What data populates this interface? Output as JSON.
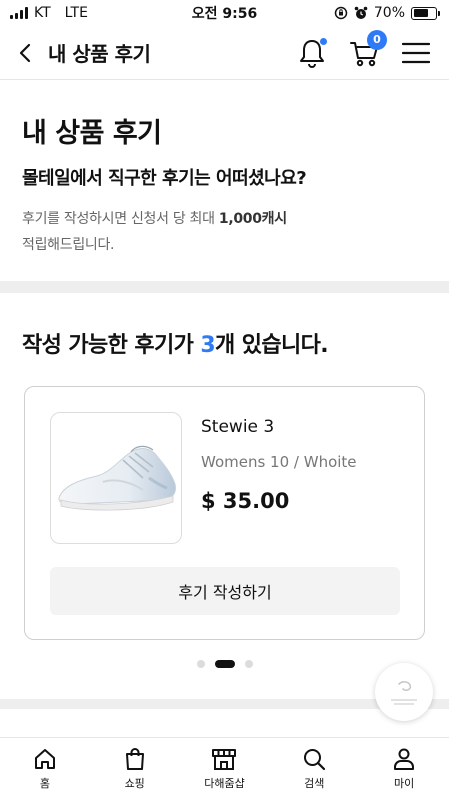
{
  "status_bar": {
    "carrier": "KT",
    "network": "LTE",
    "time": "오전 9:56",
    "battery": "70%",
    "battery_level": 0.7
  },
  "header": {
    "title": "내 상품 후기",
    "cart_count": "0",
    "icons": [
      "back-icon",
      "bell-icon",
      "cart-icon",
      "menu-icon"
    ]
  },
  "intro": {
    "title": "내 상품 후기",
    "subtitle": "몰테일에서 직구한 후기는 어떠셨나요?",
    "desc_prefix": "후기를 작성하시면 신청서 당 최대 ",
    "desc_highlight": "1,000캐시",
    "desc_suffix": "적립해드립니다."
  },
  "available": {
    "title_prefix": "작성 가능한 후기가 ",
    "count": "3",
    "title_suffix": "개 있습니다."
  },
  "review_card": {
    "product_name": "Stewie 3",
    "product_option": "Womens 10 / Whoite",
    "price": "$ 35.00",
    "button_label": "후기 작성하기"
  },
  "pagination": {
    "total": 3,
    "active_index": 1
  },
  "tab_bar": {
    "items": [
      {
        "label": "홈",
        "icon": "home-icon"
      },
      {
        "label": "쇼핑",
        "icon": "shopping-bag-icon"
      },
      {
        "label": "다해줌샵",
        "icon": "store-icon"
      },
      {
        "label": "검색",
        "icon": "search-icon"
      },
      {
        "label": "마이",
        "icon": "person-icon"
      }
    ]
  },
  "colors": {
    "accent": "#2f7bf5",
    "text": "#111111",
    "muted": "#777777",
    "band": "#eeeeee"
  }
}
